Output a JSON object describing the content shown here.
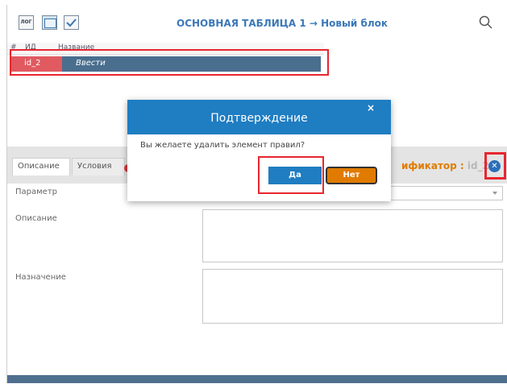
{
  "toolbar": {
    "log_icon_text": "ЛОГ",
    "title": "ОСНОВНАЯ ТАБЛИЦА 1 → Новый блок"
  },
  "grid": {
    "columns": [
      "#",
      "ИД",
      "Название"
    ],
    "rows": [
      {
        "num": "",
        "id": "id_2",
        "name": "Ввести"
      }
    ]
  },
  "tabs": [
    "Описание",
    "Условия"
  ],
  "identifier": {
    "label": "ификатор :",
    "value": "id_2"
  },
  "form": {
    "param_label": "Параметр",
    "desc_label": "Описание",
    "purpose_label": "Назначение"
  },
  "modal": {
    "title": "Подтверждение",
    "close": "×",
    "message": "Вы желаете удалить элемент правил?",
    "yes": "Да",
    "no": "Нет"
  },
  "colors": {
    "accent": "#1f7dc2",
    "warning": "#e07b00",
    "highlight": "#e8262f"
  }
}
